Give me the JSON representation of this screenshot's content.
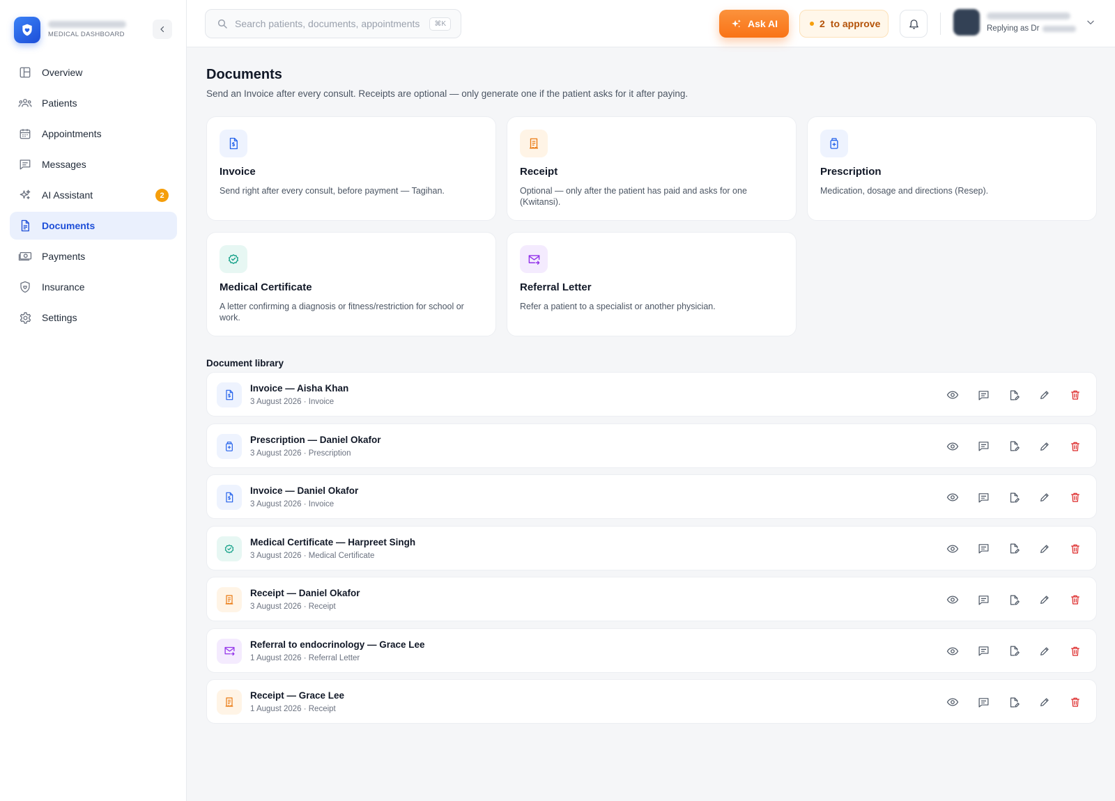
{
  "brand": {
    "subtitle": "MEDICAL DASHBOARD"
  },
  "nav": [
    {
      "label": "Overview",
      "icon": "layout-icon"
    },
    {
      "label": "Patients",
      "icon": "users-icon"
    },
    {
      "label": "Appointments",
      "icon": "calendar-icon"
    },
    {
      "label": "Messages",
      "icon": "message-icon"
    },
    {
      "label": "AI Assistant",
      "icon": "sparkles-icon",
      "badge": "2"
    },
    {
      "label": "Documents",
      "icon": "document-icon",
      "active": true
    },
    {
      "label": "Payments",
      "icon": "cash-icon"
    },
    {
      "label": "Insurance",
      "icon": "shield-icon"
    },
    {
      "label": "Settings",
      "icon": "gear-icon"
    }
  ],
  "topbar": {
    "search_placeholder": "Search patients, documents, appointments",
    "search_shortcut": "⌘K",
    "ask_ai": "Ask AI",
    "approve_count": "2",
    "approve_label": "to approve",
    "user_role": "Replying as Dr"
  },
  "page": {
    "title": "Documents",
    "subtitle": "Send an Invoice after every consult. Receipts are optional — only generate one if the patient asks for it after paying."
  },
  "cards": [
    {
      "title": "Invoice",
      "desc": "Send right after every consult, before payment — Tagihan.",
      "type": "invoice"
    },
    {
      "title": "Receipt",
      "desc": "Optional — only after the patient has paid and asks for one (Kwitansi).",
      "type": "receipt"
    },
    {
      "title": "Prescription",
      "desc": "Medication, dosage and directions (Resep).",
      "type": "prescription"
    },
    {
      "title": "Medical Certificate",
      "desc": "A letter confirming a diagnosis or fitness/restriction for school or work.",
      "type": "certificate"
    },
    {
      "title": "Referral Letter",
      "desc": "Refer a patient to a specialist or another physician.",
      "type": "referral"
    }
  ],
  "library": {
    "title": "Document library",
    "rows": [
      {
        "title": "Invoice — Aisha Khan",
        "meta": "3 August 2026 · Invoice",
        "type": "invoice"
      },
      {
        "title": "Prescription — Daniel Okafor",
        "meta": "3 August 2026 · Prescription",
        "type": "prescription"
      },
      {
        "title": "Invoice — Daniel Okafor",
        "meta": "3 August 2026 · Invoice",
        "type": "invoice"
      },
      {
        "title": "Medical Certificate — Harpreet Singh",
        "meta": "3 August 2026 · Medical Certificate",
        "type": "certificate"
      },
      {
        "title": "Receipt — Daniel Okafor",
        "meta": "3 August 2026 · Receipt",
        "type": "receipt"
      },
      {
        "title": "Referral to endocrinology — Grace Lee",
        "meta": "1 August 2026 · Referral Letter",
        "type": "referral"
      },
      {
        "title": "Receipt — Grace Lee",
        "meta": "1 August 2026 · Receipt",
        "type": "receipt"
      }
    ]
  },
  "colors": {
    "primary": "#1d4ed8",
    "accent_orange": "#f97316",
    "danger": "#dc2626",
    "teal": "#0f9f86",
    "purple": "#9333ea"
  }
}
